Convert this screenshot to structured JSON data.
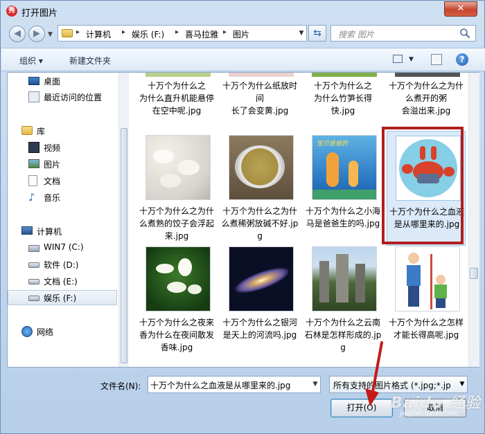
{
  "window": {
    "title": "打开图片",
    "close_glyph": "✕"
  },
  "address_bar": {
    "breadcrumbs": [
      "计算机",
      "娱乐 (F:)",
      "喜马拉雅",
      "图片"
    ]
  },
  "search": {
    "placeholder": "搜索 图片"
  },
  "toolbar": {
    "organize_label": "组织 ▾",
    "new_folder_label": "新建文件夹"
  },
  "sidebar": {
    "items": [
      {
        "label": "桌面",
        "icon": "desktop-icon"
      },
      {
        "label": "最近访问的位置",
        "icon": "recent-places-icon"
      },
      {
        "label": "库",
        "icon": "library-icon"
      },
      {
        "label": "视频",
        "icon": "video-icon"
      },
      {
        "label": "图片",
        "icon": "pictures-icon"
      },
      {
        "label": "文档",
        "icon": "documents-icon"
      },
      {
        "label": "音乐",
        "icon": "music-icon"
      },
      {
        "label": "计算机",
        "icon": "computer-icon"
      },
      {
        "label": "WIN7 (C:)",
        "icon": "system-drive-icon"
      },
      {
        "label": "软件 (D:)",
        "icon": "drive-icon"
      },
      {
        "label": "文档 (E:)",
        "icon": "drive-icon"
      },
      {
        "label": "娱乐 (F:)",
        "icon": "drive-icon",
        "selected": true
      },
      {
        "label": "网络",
        "icon": "network-icon"
      }
    ]
  },
  "files": {
    "top_row": [
      "为什么直升机能悬停在空中呢.jpg",
      "长了会变黄.jpg",
      "为什么竹笋长得快.jpg",
      "会溢出来.jpg"
    ],
    "top_row_partial": [
      "十万个为什么之",
      "十万个为什么纸放时间",
      "十万个为什么之",
      "十万个为什么之为什么煮开的粥"
    ],
    "tiles": [
      {
        "name": "十万个为什么之为什么煮熟的饺子会浮起来.jpg",
        "thumb": "dumplings"
      },
      {
        "name": "十万个为什么之为什么煮稀粥放碱不好.jpg",
        "thumb": "porridge"
      },
      {
        "name": "十万个为什么之小海马是爸爸生的吗.jpg",
        "thumb": "seahorse",
        "caption_text": "宝贝爸爸的"
      },
      {
        "name": "十万个为什么之血液是从哪里来的.jpg",
        "thumb": "crab",
        "selected": true
      },
      {
        "name": "十万个为什么之夜来香为什么在夜间散发香味.jpg",
        "thumb": "flower"
      },
      {
        "name": "十万个为什么之银河是天上的河流吗.jpg",
        "thumb": "galaxy"
      },
      {
        "name": "十万个为什么之云南石林是怎样形成的.jpg",
        "thumb": "stone-forest"
      },
      {
        "name": "十万个为什么之怎样才能长得高呢.jpg",
        "thumb": "height"
      }
    ]
  },
  "bottom": {
    "filename_label": "文件名(N):",
    "filename_value": "十万个为什么之血液是从哪里来的.jpg",
    "filter_value": "所有支持的图片格式 (*.jpg;*.jp",
    "open_label": "打开(O)",
    "cancel_label": "取消"
  },
  "watermark": {
    "text": "Baidu 经验",
    "sub": "jingyan.baidu.com"
  }
}
